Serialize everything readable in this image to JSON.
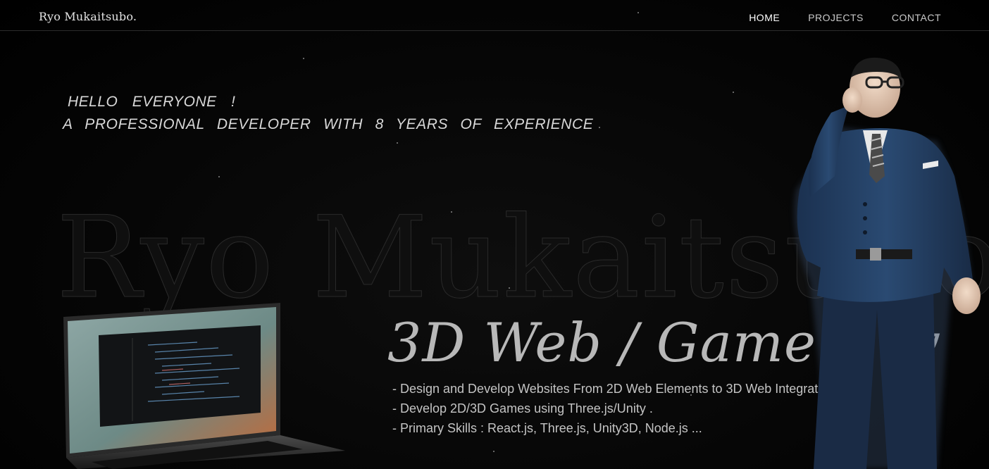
{
  "header": {
    "brand": "Ryo Mukaitsubo.",
    "nav": [
      {
        "label": "HOME",
        "active": true
      },
      {
        "label": "PROJECTS",
        "active": false
      },
      {
        "label": "CONTACT",
        "active": false
      }
    ]
  },
  "hero": {
    "greeting": "HELLO EVERYONE !",
    "tagline": "A PROFESSIONAL DEVELOPER WITH 8 YEARS OF EXPERIENCE",
    "watermark": "Ryo Mukaitsubo",
    "headline": "3D Web / Game Dev",
    "bullets": [
      "- Design and Develop Websites From 2D Web Elements to 3D Web Integrations.",
      "- Develop 2D/3D Games using Three.js/Unity .",
      "- Primary  Skills :  React.js, Three.js, Unity3D, Node.js ..."
    ]
  },
  "colors": {
    "background": "#000000",
    "text": "#d8d8d8",
    "nav_active": "#ffffff",
    "suit": "#1f3a5c"
  },
  "icons": {
    "laptop": "laptop-illustration",
    "avatar": "3d-character-avatar"
  }
}
